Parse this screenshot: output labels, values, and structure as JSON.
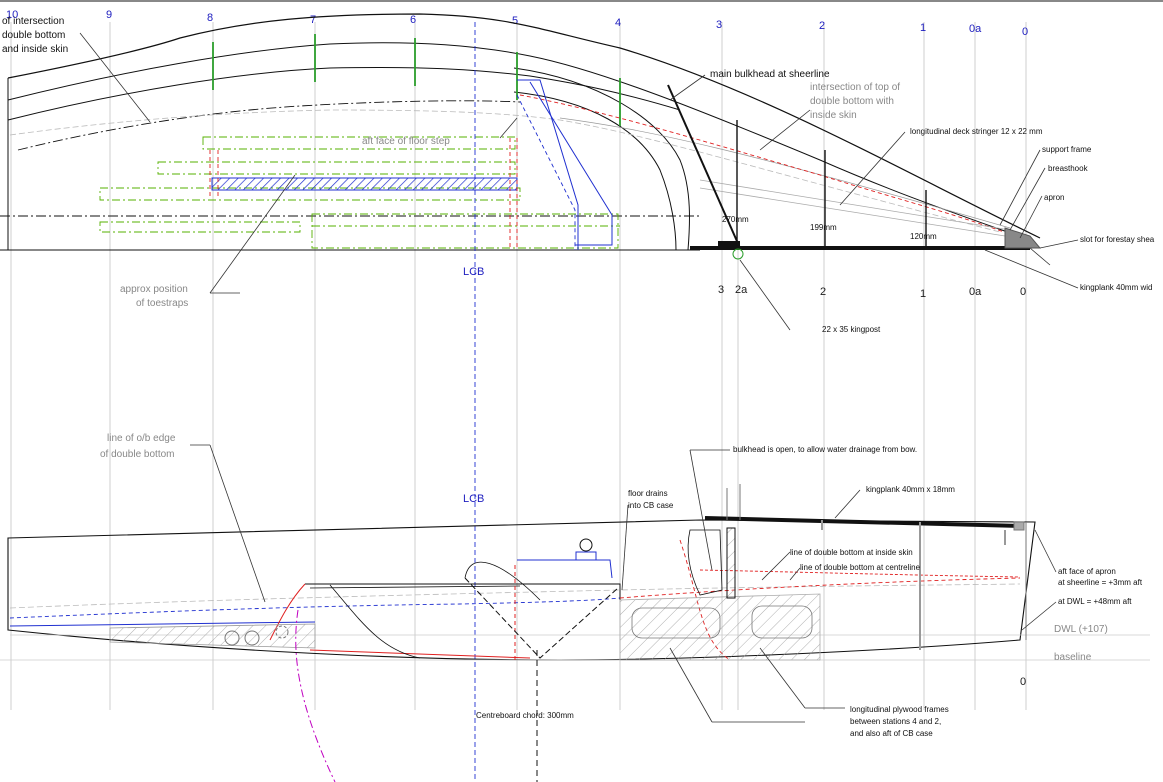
{
  "stations_top": [
    "10",
    "9",
    "8",
    "7",
    "6",
    "5",
    "4",
    "3",
    "2",
    "1",
    "0a",
    "0"
  ],
  "stations_mid": [
    "3",
    "2a",
    "2",
    "1",
    "0a",
    "0"
  ],
  "station_bottom": "0",
  "labels": {
    "intersection_double_bottom": [
      "of intersection",
      "double bottom",
      "and inside skin"
    ],
    "main_bulkhead": "main bulkhead at sheerline",
    "intersection_top_double_bottom": [
      "intersection of top of",
      "double bottom with",
      "inside skin"
    ],
    "aft_face_floor_step": "aft face of floor  step",
    "deck_stringer": "longitudinal deck stringer 12 x 22 mm",
    "support_frame": "support frame",
    "breasthook": "breasthook",
    "apron": "apron",
    "forestay_slot": "slot for forestay shea",
    "kingplank_top": "kingplank 40mm wid",
    "kingpost": "22 x 35 kingpost",
    "toestraps": [
      "approx position",
      "of toestraps"
    ],
    "dim_270": "270mm",
    "dim_199": "199mm",
    "dim_120": "120mm",
    "lcb_top": "LCB",
    "lcb_bottom": "LCB",
    "ob_edge": [
      "line of o/b edge",
      "of double bottom"
    ],
    "bulkhead_open": "bulkhead is open, to allow water drainage from bow.",
    "kingplank_bottom": "kingplank 40mm x 18mm",
    "floor_drains": [
      "floor drains",
      "into CB case"
    ],
    "line_inside_skin": "line of double bottom at inside skin",
    "line_centreline": "line of double bottom at centreline",
    "apron_face_sheer": [
      "aft face of apron",
      "at sheerline = +3mm  aft"
    ],
    "apron_face_dwl": "at DWL = +48mm  aft",
    "dwl": "DWL (+107)",
    "baseline": "baseline",
    "centreboard": "Centreboard chord: 300mm",
    "ply_frames": [
      "longitudinal plywood frames",
      "between stations 4 and 2,",
      "and also aft of CB case"
    ]
  },
  "colors": {
    "outline": "#111111",
    "station_lines": "#c8c8c8",
    "station_text": "#2020c0",
    "green_frames": "#2a9d2a",
    "green_dashdot": "#55b000",
    "red": "#e02020",
    "blue": "#2030d0",
    "magenta": "#c000c0",
    "hatch_grey": "#d8d8d8"
  }
}
